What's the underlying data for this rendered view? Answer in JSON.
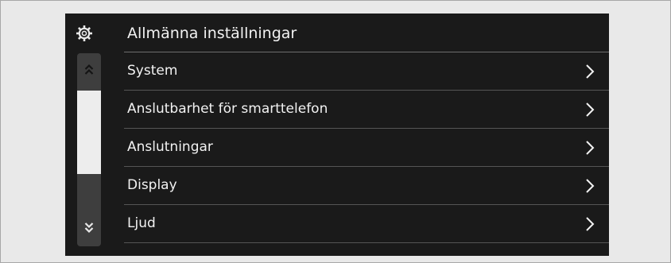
{
  "header": {
    "title": "Allmänna inställningar",
    "icon": "gear-icon"
  },
  "menu": {
    "items": [
      {
        "label": "System",
        "icon": "chevron-right-icon"
      },
      {
        "label": "Anslutbarhet för smarttelefon",
        "icon": "chevron-right-icon"
      },
      {
        "label": "Anslutningar",
        "icon": "chevron-right-icon"
      },
      {
        "label": "Display",
        "icon": "chevron-right-icon"
      },
      {
        "label": "Ljud",
        "icon": "chevron-right-icon"
      }
    ]
  },
  "scrollbar": {
    "up_icon": "double-chevron-up-icon",
    "down_icon": "double-chevron-down-icon"
  },
  "colors": {
    "screen_background": "#1a1a1a",
    "page_background": "#e9e9e9",
    "text": "#f2f2f2",
    "divider": "#555555",
    "scroll_thumb": "#ededed",
    "scroll_track": "#3e3e3e"
  }
}
